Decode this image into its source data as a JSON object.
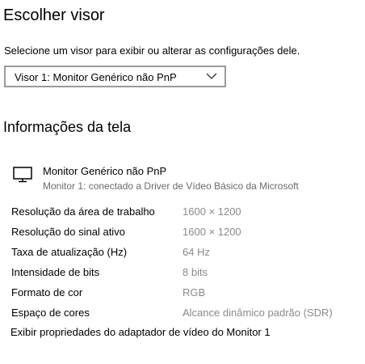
{
  "page": {
    "title": "Escolher visor",
    "description": "Selecione um visor para exibir ou alterar as configurações dele."
  },
  "display_select": {
    "selected": "Visor 1: Monitor Genérico não PnP",
    "icon": "chevron-down-icon"
  },
  "info": {
    "title": "Informações da tela",
    "monitor": {
      "icon": "monitor-icon",
      "name": "Monitor Genérico não PnP",
      "subtitle": "Monitor 1: conectado a Driver de Vídeo Básico da Microsoft"
    },
    "rows": [
      {
        "label": "Resolução da área de trabalho",
        "value": "1600 × 1200"
      },
      {
        "label": "Resolução do sinal ativo",
        "value": "1600 × 1200"
      },
      {
        "label": "Taxa de atualização (Hz)",
        "value": "64 Hz"
      },
      {
        "label": "Intensidade de bits",
        "value": "8 bits"
      },
      {
        "label": "Formato de cor",
        "value": "RGB"
      },
      {
        "label": "Espaço de cores",
        "value": "Alcance dinâmico padrão (SDR)"
      }
    ],
    "adapter_link": "Exibir propriedades do adaptador de vídeo do Monitor 1"
  }
}
